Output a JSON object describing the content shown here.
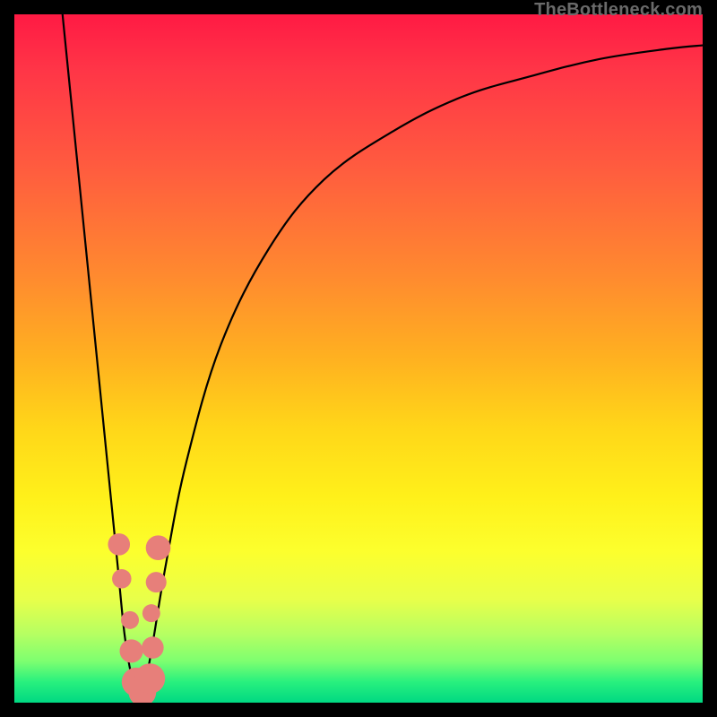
{
  "watermark": "TheBottleneck.com",
  "colors": {
    "curve_stroke": "#000000",
    "marker_fill": "#e77f7a",
    "frame_bg": "#000000"
  },
  "chart_data": {
    "type": "line",
    "title": "",
    "xlabel": "",
    "ylabel": "",
    "xlim": [
      0,
      100
    ],
    "ylim": [
      0,
      100
    ],
    "note": "Axes are unlabeled in the source image; values are estimated from pixel positions with (0,0) at bottom-left of the gradient plot area.",
    "series": [
      {
        "name": "left-branch",
        "x": [
          7.0,
          9.0,
          10.5,
          12.0,
          13.5,
          15.0,
          16.0,
          17.0,
          18.0
        ],
        "y": [
          100.0,
          80.0,
          65.0,
          50.0,
          35.0,
          20.0,
          10.0,
          4.0,
          1.0
        ]
      },
      {
        "name": "right-branch",
        "x": [
          18.0,
          19.0,
          20.0,
          22.0,
          25.0,
          30.0,
          37.0,
          45.0,
          55.0,
          65.0,
          75.0,
          85.0,
          95.0,
          100.0
        ],
        "y": [
          1.0,
          3.0,
          8.0,
          20.0,
          35.0,
          52.0,
          66.0,
          76.0,
          83.0,
          88.0,
          91.0,
          93.5,
          95.0,
          95.5
        ]
      }
    ],
    "markers": {
      "name": "data-points",
      "x": [
        15.2,
        15.6,
        16.8,
        17.0,
        17.7,
        18.6,
        19.7,
        20.1,
        19.9,
        20.6,
        20.9
      ],
      "y": [
        23.0,
        18.0,
        12.0,
        7.5,
        3.0,
        1.5,
        3.5,
        8.0,
        13.0,
        17.5,
        22.5
      ],
      "r": [
        1.6,
        1.4,
        1.3,
        1.7,
        2.1,
        2.0,
        2.2,
        1.6,
        1.3,
        1.5,
        1.8
      ]
    }
  }
}
